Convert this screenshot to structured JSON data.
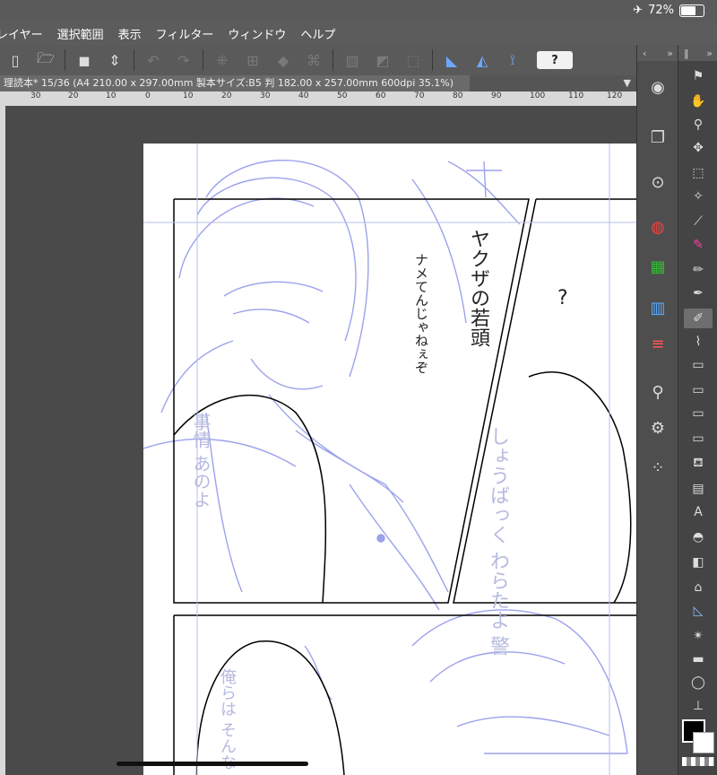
{
  "status": {
    "battery": "72%",
    "battery_level": 0.72
  },
  "menu": [
    "レイヤー",
    "選択範囲",
    "表示",
    "フィルター",
    "ウィンドウ",
    "ヘルプ"
  ],
  "tab": {
    "title": "理読本* 15/36 (A4 210.00 x 297.00mm 製本サイズ:B5 判 182.00 x 257.00mm 600dpi 35.1%)"
  },
  "ruler": [
    "30",
    "20",
    "10",
    "0",
    "10",
    "20",
    "30",
    "40",
    "50",
    "60",
    "70",
    "80",
    "90",
    "100",
    "110",
    "120"
  ],
  "canvas": {
    "annotation1_lines": [
      "ヤクザの",
      "若頭"
    ],
    "annotation2_lines": [
      "ナメてんじゃねぇぞ"
    ],
    "question": "?",
    "balloon1_lines": [
      "しょうばっく",
      "わらたよ",
      "警"
    ],
    "balloon2_lines": [
      "事情",
      "あのよ"
    ],
    "balloon3_lines": [
      "俺らは",
      "そんな"
    ]
  },
  "icons": {
    "help": "?"
  }
}
